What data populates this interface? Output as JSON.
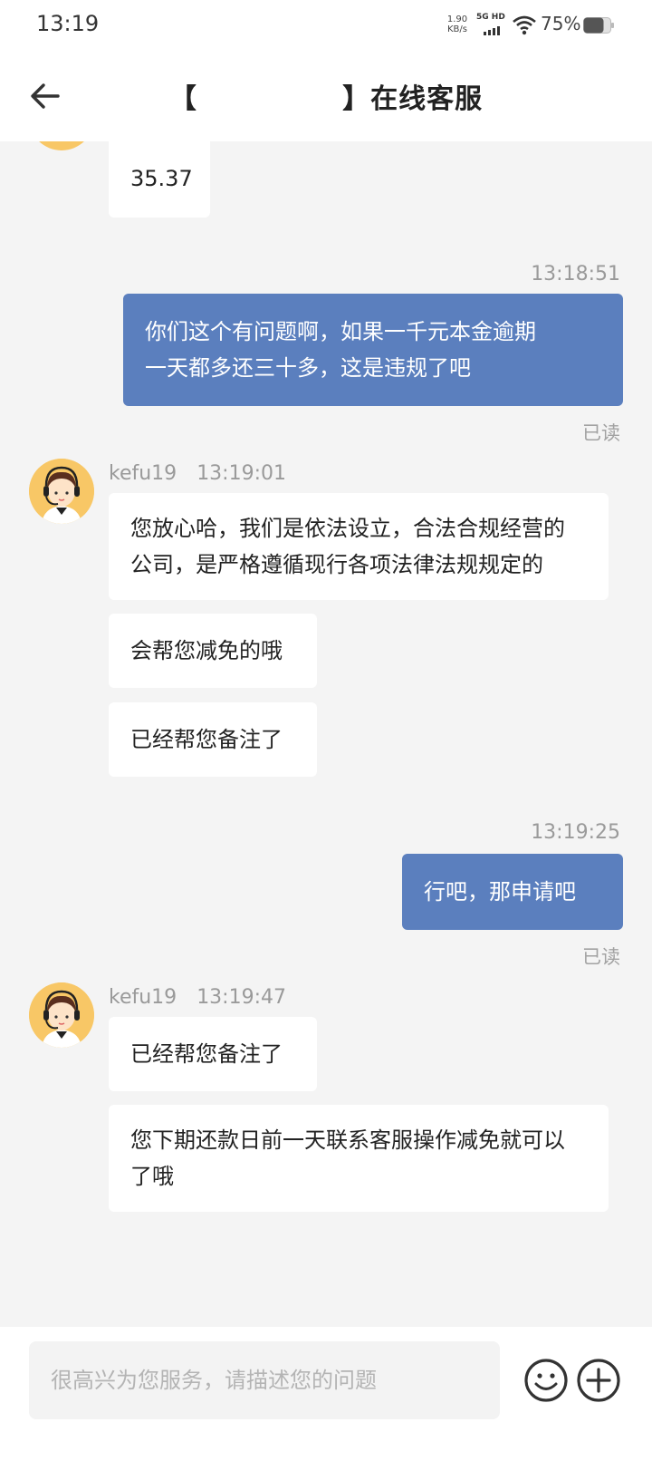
{
  "status_bar": {
    "time": "13:19",
    "net_speed_value": "1.90",
    "net_speed_unit": "KB/s",
    "network": "5G HD",
    "battery": "75%"
  },
  "header": {
    "title": "【              】在线客服"
  },
  "messages": [
    {
      "from": "agent",
      "text": "35.37"
    },
    {
      "timestamp": "13:18:51"
    },
    {
      "from": "user",
      "lines": [
        "你们这个有问题啊，如果一千元本金逾期",
        "一天都多还三十多，这是违规了吧"
      ],
      "status": "已读"
    },
    {
      "from": "agent",
      "name": "kefu19",
      "time": "13:19:01",
      "lines": [
        "您放心哈，我们是依法设立，合法合规经营的",
        "公司，是严格遵循现行各项法律法规规定的"
      ]
    },
    {
      "from": "agent",
      "text": "会帮您减免的哦"
    },
    {
      "from": "agent",
      "text": "已经帮您备注了"
    },
    {
      "timestamp": "13:19:25"
    },
    {
      "from": "user",
      "text": "行吧，那申请吧",
      "status": "已读"
    },
    {
      "from": "agent",
      "name": "kefu19",
      "time": "13:19:47",
      "text": "已经帮您备注了"
    },
    {
      "from": "agent",
      "lines": [
        "您下期还款日前一天联系客服操作减免就可以",
        "了哦"
      ]
    }
  ],
  "input": {
    "placeholder": "很高兴为您服务，请描述您的问题"
  },
  "icons": {
    "back": "arrow-left-icon",
    "emoji": "smiley-icon",
    "more": "plus-circle-icon",
    "avatar": "customer-service-agent-avatar"
  },
  "colors": {
    "user_bubble": "#5b7fbe",
    "agent_bubble": "#ffffff",
    "background": "#f4f4f4",
    "avatar_bg": "#f8c766"
  }
}
